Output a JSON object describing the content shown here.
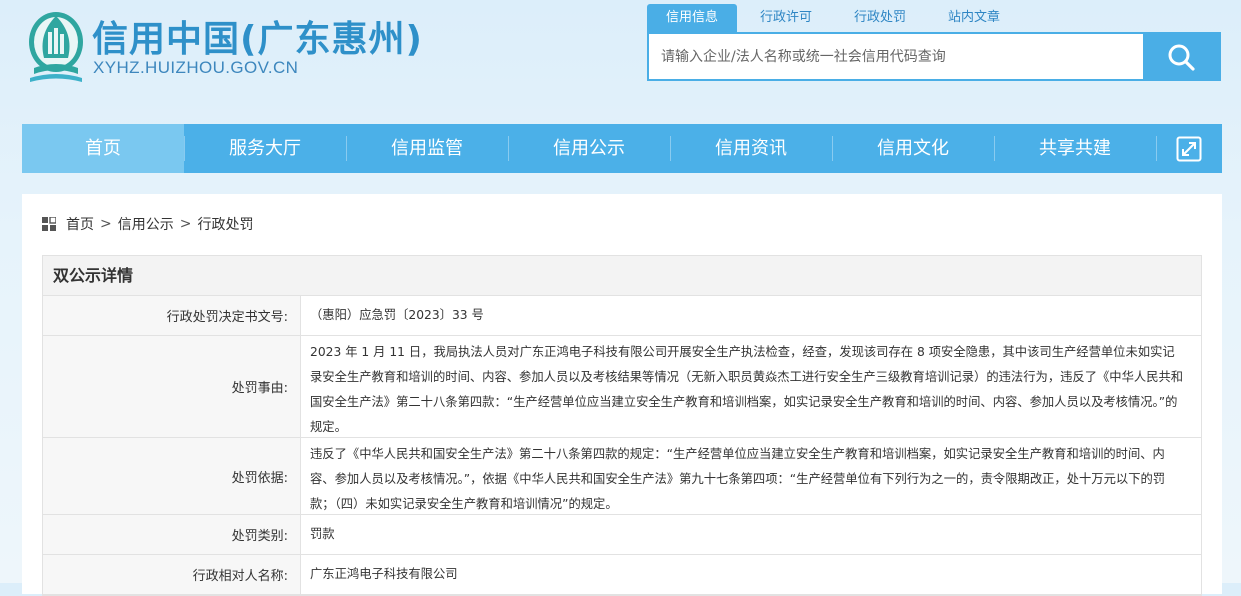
{
  "header": {
    "site_title": "信用中国(广东惠州)",
    "site_domain": "XYHZ.HUIZHOU.GOV.CN",
    "search_tabs": [
      "信用信息",
      "行政许可",
      "行政处罚",
      "站内文章"
    ],
    "search_placeholder": "请输入企业/法人名称或统一社会信用代码查询"
  },
  "nav": {
    "items": [
      "首页",
      "服务大厅",
      "信用监管",
      "信用公示",
      "信用资讯",
      "信用文化",
      "共享共建"
    ]
  },
  "breadcrumb": {
    "items": [
      "首页",
      "信用公示",
      "行政处罚"
    ],
    "separator": ">"
  },
  "detail": {
    "title": "双公示详情",
    "rows": [
      {
        "label": "行政处罚决定书文号:",
        "value": "（惠阳）应急罚〔2023〕33 号"
      },
      {
        "label": "处罚事由:",
        "value": "2023 年 1 月 11 日，我局执法人员对广东正鸿电子科技有限公司开展安全生产执法检查，经查，发现该司存在 8 项安全隐患，其中该司生产经营单位未如实记录安全生产教育和培训的时间、内容、参加人员以及考核结果等情况（无新入职员黄焱杰工进行安全生产三级教育培训记录）的违法行为，违反了《中华人民共和国安全生产法》第二十八条第四款：“生产经营单位应当建立安全生产教育和培训档案，如实记录安全生产教育和培训的时间、内容、参加人员以及考核情况。”的规定。"
      },
      {
        "label": "处罚依据:",
        "value": "违反了《中华人民共和国安全生产法》第二十八条第四款的规定：“生产经营单位应当建立安全生产教育和培训档案，如实记录安全生产教育和培训的时间、内容、参加人员以及考核情况。”，依据《中华人民共和国安全生产法》第九十七条第四项：“生产经营单位有下列行为之一的，责令限期改正，处十万元以下的罚款；（四）未如实记录安全生产教育和培训情况”的规定。"
      },
      {
        "label": "处罚类别:",
        "value": "罚款"
      },
      {
        "label": "行政相对人名称:",
        "value": "广东正鸿电子科技有限公司"
      }
    ]
  },
  "colors": {
    "accent": "#4bb0e8",
    "nav_active": "#7ac8f0",
    "title_blue": "#2e90c9"
  },
  "icons": {
    "logo": "emblem-logo",
    "search": "search-icon",
    "expand": "expand-icon",
    "breadcrumb": "grid-icon"
  }
}
